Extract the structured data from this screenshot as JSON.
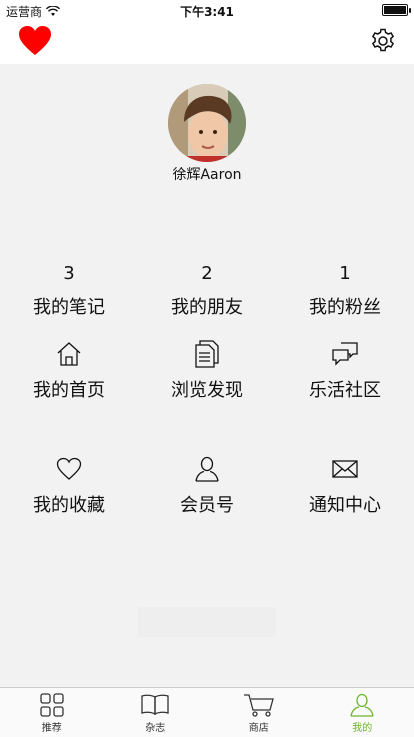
{
  "status_bar": {
    "carrier": "运营商",
    "time": "下午3:41"
  },
  "nav": {
    "left_icon": "heart-icon",
    "right_icon": "gear-icon"
  },
  "profile": {
    "name": "徐辉Aaron"
  },
  "stats": [
    {
      "count": "3",
      "label": "我的笔记"
    },
    {
      "count": "2",
      "label": "我的朋友"
    },
    {
      "count": "1",
      "label": "我的粉丝"
    }
  ],
  "menu": [
    {
      "label": "我的首页",
      "icon": "home-icon"
    },
    {
      "label": "浏览发现",
      "icon": "document-icon"
    },
    {
      "label": "乐活社区",
      "icon": "chat-bubbles-icon"
    },
    {
      "label": "我的收藏",
      "icon": "heart-outline-icon"
    },
    {
      "label": "会员号",
      "icon": "user-icon"
    },
    {
      "label": "通知中心",
      "icon": "envelope-icon"
    }
  ],
  "tabs": [
    {
      "label": "推荐",
      "icon": "grid-icon"
    },
    {
      "label": "杂志",
      "icon": "book-icon"
    },
    {
      "label": "商店",
      "icon": "cart-icon"
    },
    {
      "label": "我的",
      "icon": "person-icon"
    }
  ],
  "colors": {
    "accent": "#6cb52c",
    "heart": "#ff0000",
    "background": "#f2f2f2"
  }
}
